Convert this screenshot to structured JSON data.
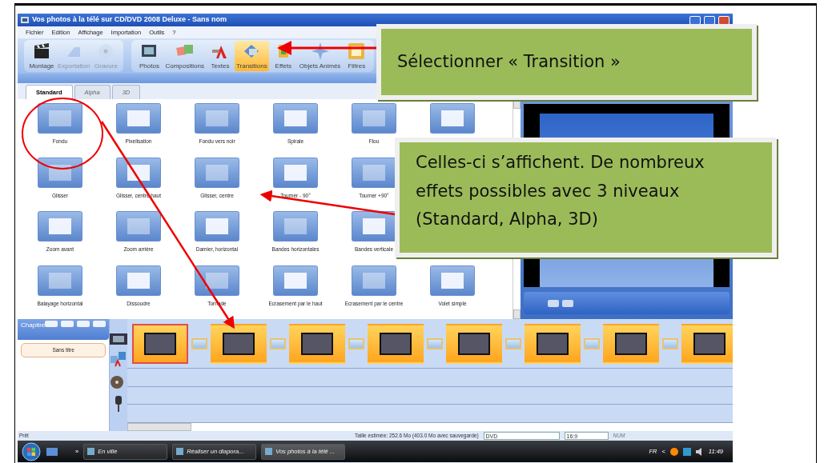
{
  "window": {
    "title": "Vos photos à la télé sur CD/DVD 2008 Deluxe - Sans nom"
  },
  "menu": [
    "Fichier",
    "Edition",
    "Affichage",
    "Importation",
    "Outils",
    "?"
  ],
  "toolbar": {
    "groups": [
      [
        {
          "label": "Montage",
          "kind": "clapper",
          "selected": false,
          "disabled": false
        },
        {
          "label": "Exportation",
          "kind": "export",
          "selected": false,
          "disabled": true
        },
        {
          "label": "Gravure",
          "kind": "disc",
          "selected": false,
          "disabled": true
        }
      ],
      [
        {
          "label": "Photos",
          "kind": "photos",
          "selected": false,
          "disabled": false
        },
        {
          "label": "Compositions",
          "kind": "compose",
          "selected": false,
          "disabled": false
        },
        {
          "label": "Textes",
          "kind": "text",
          "selected": false,
          "disabled": false
        },
        {
          "label": "Transitions",
          "kind": "transition",
          "selected": true,
          "disabled": false
        },
        {
          "label": "Effets",
          "kind": "effect",
          "selected": false,
          "disabled": false
        },
        {
          "label": "Objets Animés",
          "kind": "anim",
          "selected": false,
          "disabled": false
        },
        {
          "label": "Filtres",
          "kind": "filter",
          "selected": false,
          "disabled": false
        }
      ]
    ]
  },
  "tabs": [
    {
      "label": "Standard",
      "selected": true
    },
    {
      "label": "Alpha",
      "selected": false
    },
    {
      "label": "3D",
      "selected": false
    }
  ],
  "transitions": {
    "rows": [
      [
        {
          "kind": "tile",
          "label": "Fondu"
        },
        {
          "kind": "tile",
          "label": "Pixelisation"
        },
        {
          "kind": "tile",
          "label": "Fondu vers noir"
        },
        {
          "kind": "tile",
          "label": "Spirale"
        },
        {
          "kind": "tile",
          "label": "Flou"
        },
        {
          "kind": "icon_only"
        }
      ],
      [
        {
          "kind": "tile",
          "label": "Glisser"
        },
        {
          "kind": "tile",
          "label": "Glisser, centre haut"
        },
        {
          "kind": "tile",
          "label": "Glisser, centre"
        },
        {
          "kind": "tile",
          "label": "Tourner - 90°"
        },
        {
          "kind": "tile",
          "label": "Tourner +90°"
        }
      ],
      [
        {
          "kind": "tile",
          "label": "Zoom avant"
        },
        {
          "kind": "tile",
          "label": "Zoom arrière"
        },
        {
          "kind": "tile",
          "label": "Damier, horizontal"
        },
        {
          "kind": "tile",
          "label": "Bandes horizontales"
        },
        {
          "kind": "tile",
          "label": "Bandes verticale"
        }
      ],
      [
        {
          "kind": "tile",
          "label": "Balayage horizontal"
        },
        {
          "kind": "tile",
          "label": "Dissoudre"
        },
        {
          "kind": "tile",
          "label": "Tornade"
        },
        {
          "kind": "tile",
          "label": "Ecrasement par le haut"
        },
        {
          "kind": "tile",
          "label": "Ecrasement par le centre"
        },
        {
          "kind": "tile",
          "label": "Volet simple"
        }
      ]
    ]
  },
  "chapters": {
    "title": "Chapitre",
    "items": [
      {
        "label": "Sans titre",
        "selected": true
      }
    ]
  },
  "timeline": {
    "slides": [
      {
        "selected": true
      },
      {
        "selected": false
      },
      {
        "selected": false
      },
      {
        "selected": false
      },
      {
        "selected": false
      },
      {
        "selected": false
      },
      {
        "selected": false
      },
      {
        "selected": false
      }
    ]
  },
  "status_bar": {
    "state": "Prêt",
    "size": "Taille estimée: 252.6 Mo  (403.0 Mo avec sauvegarde)",
    "format": "DVD",
    "ratio": "16:9",
    "num": "NUM"
  },
  "taskbar": {
    "more": "»",
    "tasks": [
      {
        "label": "En ville",
        "selected": false
      },
      {
        "label": "Réaliser un diapora...",
        "selected": false
      },
      {
        "label": "Vos photos à la télé ...",
        "selected": true
      }
    ],
    "language": "FR",
    "tray_toggle": "<",
    "clock": "11:49"
  },
  "callouts": [
    {
      "text": "Sélectionner « Transition »"
    },
    {
      "text": "Celles-ci s’affichent. De nombreux effets possibles avec 3 niveaux (Standard, Alpha, 3D)"
    }
  ]
}
